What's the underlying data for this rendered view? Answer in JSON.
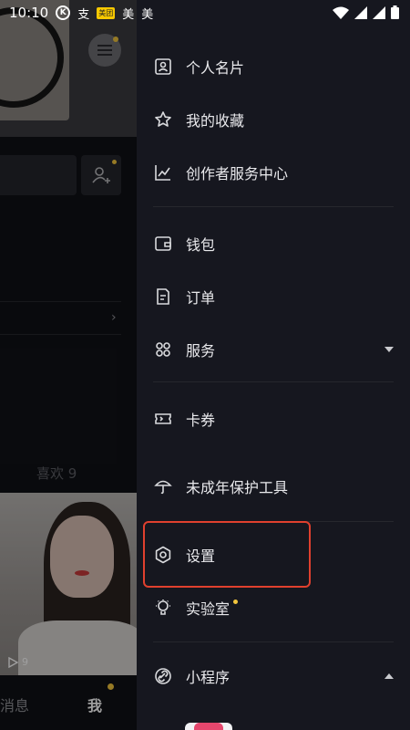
{
  "status_bar": {
    "time": "10:10",
    "icons": [
      "k-circle-icon",
      "alipay-icon",
      "meituan-icon",
      "mei-icon",
      "mei-icon"
    ],
    "meituan_label": "美团",
    "mei_1": "美",
    "mei_2": "美",
    "alipay_glyph": "支",
    "k_glyph": "K"
  },
  "profile": {
    "likes_label": "喜欢 9",
    "video_play_count": "9",
    "nav_messages": "消息",
    "nav_me": "我"
  },
  "drawer": {
    "items": [
      {
        "label": "个人名片",
        "icon": "id-card-icon"
      },
      {
        "label": "我的收藏",
        "icon": "star-icon"
      },
      {
        "label": "创作者服务中心",
        "icon": "chart-icon"
      },
      {
        "label": "钱包",
        "icon": "wallet-icon"
      },
      {
        "label": "订单",
        "icon": "order-icon"
      },
      {
        "label": "服务",
        "icon": "grid-icon"
      },
      {
        "label": "卡券",
        "icon": "ticket-icon"
      },
      {
        "label": "未成年保护工具",
        "icon": "umbrella-icon"
      },
      {
        "label": "设置",
        "icon": "gear-icon"
      },
      {
        "label": "实验室",
        "icon": "bulb-icon"
      },
      {
        "label": "小程序",
        "icon": "link-icon"
      }
    ]
  },
  "colors": {
    "background": "#16171f",
    "accent_dot": "#f2c53d",
    "highlight_border": "#e0402e"
  }
}
